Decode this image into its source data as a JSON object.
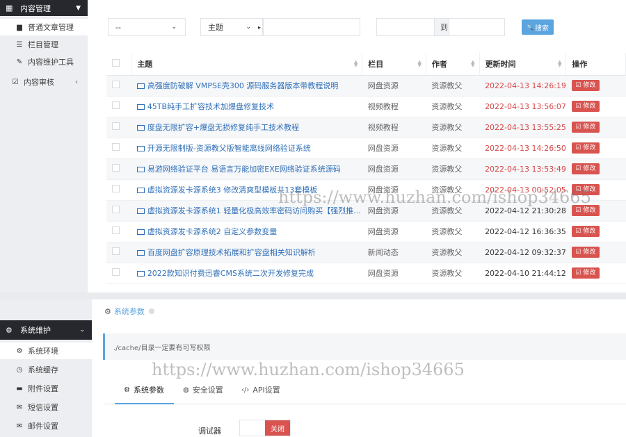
{
  "top_panel": {
    "sidebar": {
      "header_label": "内容管理",
      "items": [
        {
          "label": "普通文章管理",
          "icon": "document-icon",
          "active": true
        },
        {
          "label": "栏目管理",
          "icon": "list-icon",
          "active": false
        },
        {
          "label": "内容维护工具",
          "icon": "wrench-icon",
          "active": false
        },
        {
          "label": "内容审核",
          "icon": "edit-icon",
          "active": false
        }
      ]
    },
    "filters": {
      "select1_value": "--",
      "select2_value": "主题",
      "date_separator": "到",
      "search_button": "搜索"
    },
    "table": {
      "headers": [
        "主题",
        "栏目",
        "作者",
        "更新时间",
        "操作"
      ],
      "rows": [
        {
          "title": "高强度防破解 VMPSE壳300 源码服务器版本带教程说明",
          "category": "网盘资源",
          "author": "资源教父",
          "time": "2022-04-13 14:26:19",
          "action": "修改"
        },
        {
          "title": "45TB纯手工扩容技术加爆盘修复技术",
          "category": "视频教程",
          "author": "资源教父",
          "time": "2022-04-13 13:56:07",
          "action": "修改"
        },
        {
          "title": "度盘无限扩容+爆盘无损修复纯手工技术教程",
          "category": "视频教程",
          "author": "资源教父",
          "time": "2022-04-13 13:55:25",
          "action": "修改"
        },
        {
          "title": "开源无限制版-资源教父版智能离线网络验证系统",
          "category": "网盘资源",
          "author": "资源教父",
          "time": "2022-04-13 14:26:50",
          "action": "修改"
        },
        {
          "title": "易游网络验证平台 易语言万能加密EXE网络验证系统源码",
          "category": "网盘资源",
          "author": "资源教父",
          "time": "2022-04-13 13:53:49",
          "action": "修改"
        },
        {
          "title": "虚拟资源发卡源系统3 修改清爽型模板共13套模板",
          "category": "网盘资源",
          "author": "资源教父",
          "time": "2022-04-13 00:52:05",
          "action": "修改"
        },
        {
          "title": "虚拟资源发卡源系统1 轻量化极高效率密码访问购买【强烈推...",
          "category": "网盘资源",
          "author": "资源教父",
          "time": "2022-04-12 21:30:28",
          "action": "修改"
        },
        {
          "title": "虚拟资源发卡源系统2 自定义参数变量",
          "category": "网盘资源",
          "author": "资源教父",
          "time": "2022-04-12 16:36:35",
          "action": "修改"
        },
        {
          "title": "百度网盘扩容原理技术拓展和扩容盘相关知识解析",
          "category": "新闻动态",
          "author": "资源教父",
          "time": "2022-04-12 09:32:37",
          "action": "修改"
        },
        {
          "title": "2022款知识付费迅睿CMS系统二次开发修复完成",
          "category": "网盘资源",
          "author": "资源教父",
          "time": "2022-04-10 21:44:12",
          "action": "修改"
        }
      ]
    },
    "watermark": "https://www.huzhan.com/ishop34665"
  },
  "bottom_panel": {
    "sidebar": {
      "header_label": "系统维护",
      "items": [
        {
          "label": "系统环境",
          "icon": "gear-icon",
          "active": true
        },
        {
          "label": "系统缓存",
          "icon": "clock-icon",
          "active": false
        },
        {
          "label": "附件设置",
          "icon": "folder-icon",
          "active": false
        },
        {
          "label": "短信设置",
          "icon": "envelope-icon",
          "active": false
        },
        {
          "label": "邮件设置",
          "icon": "mail-icon",
          "active": false
        }
      ]
    },
    "breadcrumb": "系统参数",
    "notice": "./cache/目录一定要有可写权限",
    "tabs": [
      {
        "label": "系统参数",
        "icon": "gear-icon",
        "active": true
      },
      {
        "label": "安全设置",
        "icon": "shield-icon",
        "active": false
      },
      {
        "label": "API设置",
        "icon": "code-icon",
        "active": false
      }
    ],
    "form": {
      "debugger_label": "调试器",
      "debugger_state": "关闭"
    },
    "watermark": "https://www.huzhan.com/ishop34665"
  },
  "colors": {
    "sidebar_header_bg": "#26282d",
    "accent_blue": "#5aa4e0",
    "danger_red": "#d9534f",
    "time_red": "#d64545",
    "link_blue": "#2f6fb8"
  }
}
